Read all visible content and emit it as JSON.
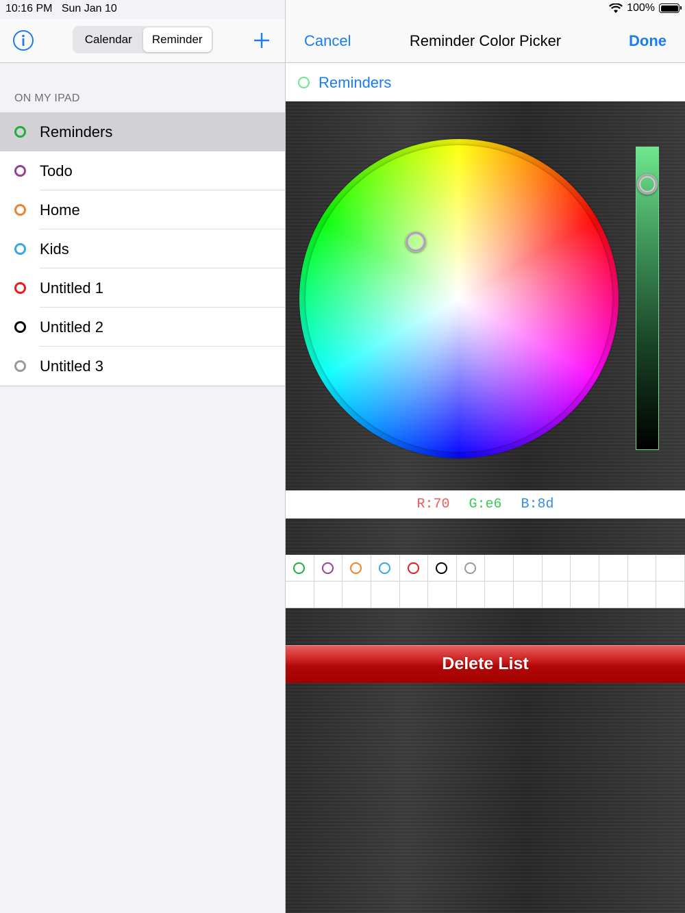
{
  "status_bar": {
    "time": "10:16 PM",
    "date": "Sun Jan 10",
    "battery_text": "100%",
    "battery_level": 1.0
  },
  "left_nav": {
    "info_icon": "info-circle-icon",
    "segments": [
      {
        "label": "Calendar",
        "selected": false
      },
      {
        "label": "Reminder",
        "selected": true
      }
    ],
    "add_icon": "plus-icon",
    "accent": "#1a7cf4"
  },
  "section_header": "ON MY IPAD",
  "lists": [
    {
      "label": "Reminders",
      "color": "#1fae3f",
      "selected": true
    },
    {
      "label": "Todo",
      "color": "#973f99",
      "selected": false
    },
    {
      "label": "Home",
      "color": "#f0822a",
      "selected": false
    },
    {
      "label": "Kids",
      "color": "#34a7f0",
      "selected": false
    },
    {
      "label": "Untitled 1",
      "color": "#f0181e",
      "selected": false
    },
    {
      "label": "Untitled 2",
      "color": "#000000",
      "selected": false
    },
    {
      "label": "Untitled 3",
      "color": "#999999",
      "selected": false
    }
  ],
  "picker": {
    "cancel_label": "Cancel",
    "title": "Reminder Color Picker",
    "done_label": "Done",
    "list_name": "Reminders",
    "current_color": "#70e68d",
    "brightness": 0.88,
    "rgb": {
      "r": "R:70",
      "g": "G:e6",
      "b": "B:8d",
      "r_color": "#f05a5a",
      "g_color": "#3ec85a",
      "b_color": "#3a8ce0"
    },
    "swatches": [
      "#1fae3f",
      "#973f99",
      "#f0822a",
      "#34a7f0",
      "#f0181e",
      "#000000",
      "#999999"
    ],
    "delete_label": "Delete List"
  }
}
